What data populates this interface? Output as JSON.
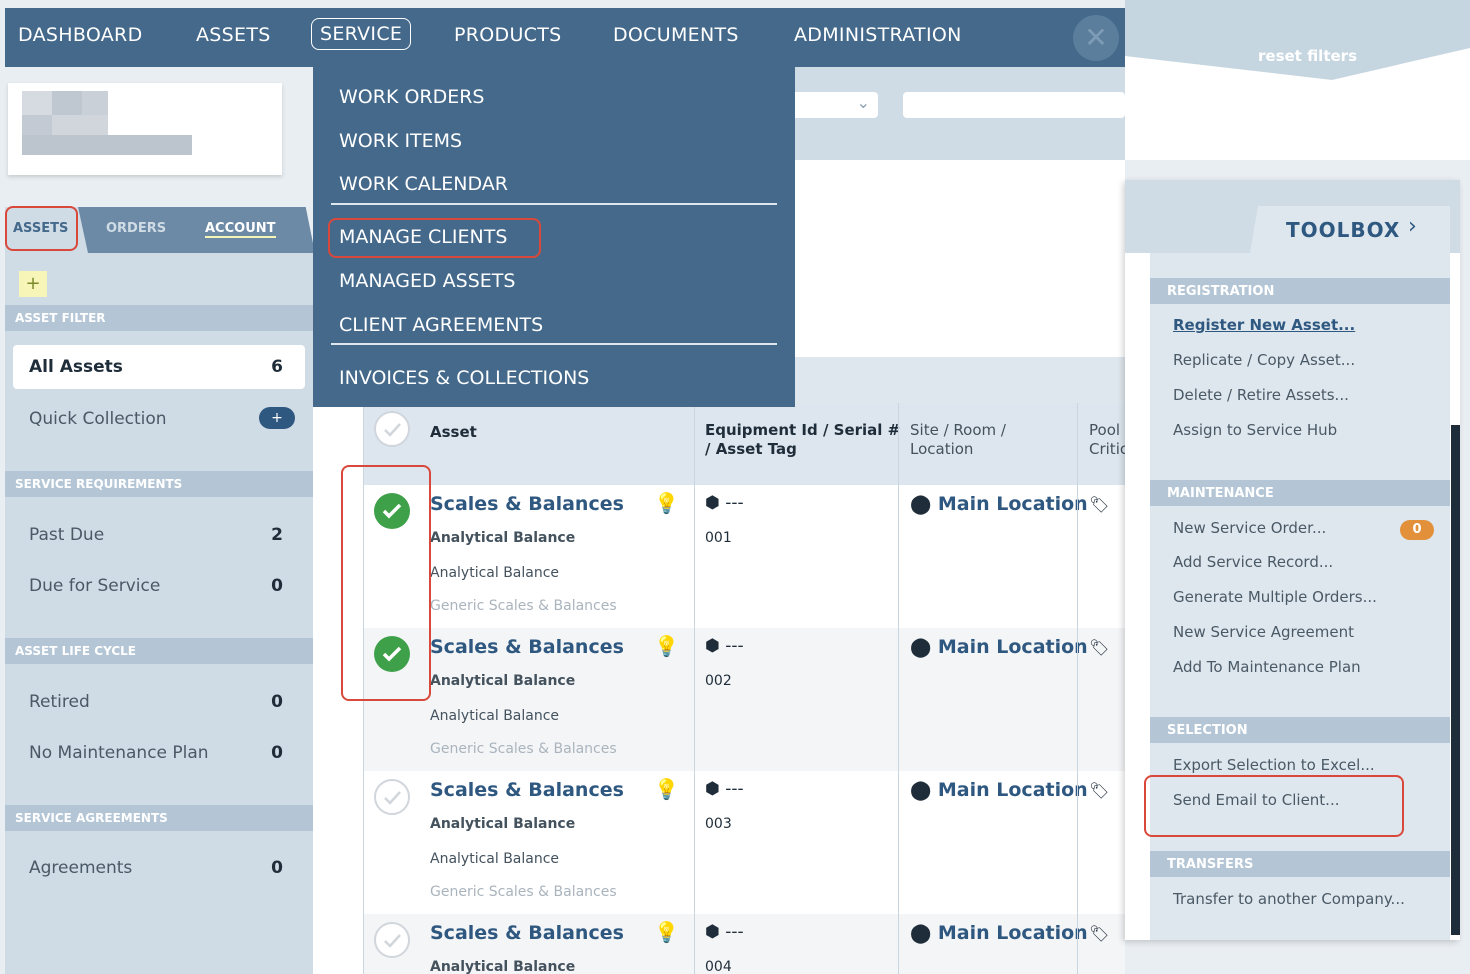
{
  "nav": {
    "items": [
      "DASHBOARD",
      "ASSETS",
      "SERVICE",
      "PRODUCTS",
      "DOCUMENTS",
      "ADMINISTRATION"
    ],
    "close_icon": "close-icon"
  },
  "filters": {
    "reset_label": "reset filters"
  },
  "service_menu": {
    "items": [
      "WORK ORDERS",
      "WORK ITEMS",
      "WORK CALENDAR",
      "MANAGE CLIENTS",
      "MANAGED ASSETS",
      "CLIENT AGREEMENTS",
      "INVOICES & COLLECTIONS"
    ]
  },
  "left_tabs": {
    "assets": "ASSETS",
    "orders": "ORDERS",
    "account": "ACCOUNT"
  },
  "sidebar": {
    "add_label": "+",
    "asset_filter": {
      "header": "ASSET FILTER",
      "items": [
        {
          "label": "All Assets",
          "count": "6"
        },
        {
          "label": "Quick Collection",
          "count": "+"
        }
      ]
    },
    "service_requirements": {
      "header": "SERVICE REQUIREMENTS",
      "items": [
        {
          "label": "Past Due",
          "count": "2"
        },
        {
          "label": "Due for Service",
          "count": "0"
        }
      ]
    },
    "asset_life_cycle": {
      "header": "ASSET LIFE CYCLE",
      "items": [
        {
          "label": "Retired",
          "count": "0"
        },
        {
          "label": "No Maintenance Plan",
          "count": "0"
        }
      ]
    },
    "service_agreements": {
      "header": "SERVICE AGREEMENTS",
      "items": [
        {
          "label": "Agreements",
          "count": "0"
        }
      ]
    }
  },
  "table": {
    "headers": {
      "asset": "Asset",
      "equip_a": "Equipment Id / Serial #",
      "equip_b": "/ Asset Tag",
      "site_a": "Site / Room /",
      "site_b": "Location",
      "pool_a": "Pool",
      "pool_b": "Critic"
    },
    "rows": [
      {
        "title": "Scales & Balances",
        "sub1": "Analytical Balance",
        "sub2": "Analytical Balance",
        "sub3": "Generic Scales & Balances",
        "equip": "---",
        "serial": "001",
        "location": "Main Location",
        "checked": true
      },
      {
        "title": "Scales & Balances",
        "sub1": "Analytical Balance",
        "sub2": "Analytical Balance",
        "sub3": "Generic Scales & Balances",
        "equip": "---",
        "serial": "002",
        "location": "Main Location",
        "checked": true
      },
      {
        "title": "Scales & Balances",
        "sub1": "Analytical Balance",
        "sub2": "Analytical Balance",
        "sub3": "Generic Scales & Balances",
        "equip": "---",
        "serial": "003",
        "location": "Main Location",
        "checked": false
      },
      {
        "title": "Scales & Balances",
        "sub1": "Analytical Balance",
        "equip": "---",
        "serial": "004",
        "location": "Main Location",
        "checked": false
      }
    ]
  },
  "toolbox": {
    "title": "TOOLBOX",
    "registration": {
      "header": "REGISTRATION",
      "items": [
        "Register New Asset...",
        "Replicate / Copy Asset...",
        "Delete / Retire Assets...",
        "Assign to Service Hub"
      ]
    },
    "maintenance": {
      "header": "MAINTENANCE",
      "items": [
        "New Service Order...",
        "Add Service Record...",
        "Generate Multiple Orders...",
        "New Service Agreement",
        "Add To Maintenance Plan"
      ],
      "new_order_badge": "0"
    },
    "selection": {
      "header": "SELECTION",
      "items": [
        "Export Selection to Excel...",
        "Send Email to Client..."
      ]
    },
    "transfers": {
      "header": "TRANSFERS",
      "items": [
        "Transfer to another Company..."
      ]
    }
  },
  "colors": {
    "nav_bg": "#44698b",
    "accent": "#2f5880",
    "highlight": "#d9493b",
    "check_green": "#3fa04a"
  }
}
